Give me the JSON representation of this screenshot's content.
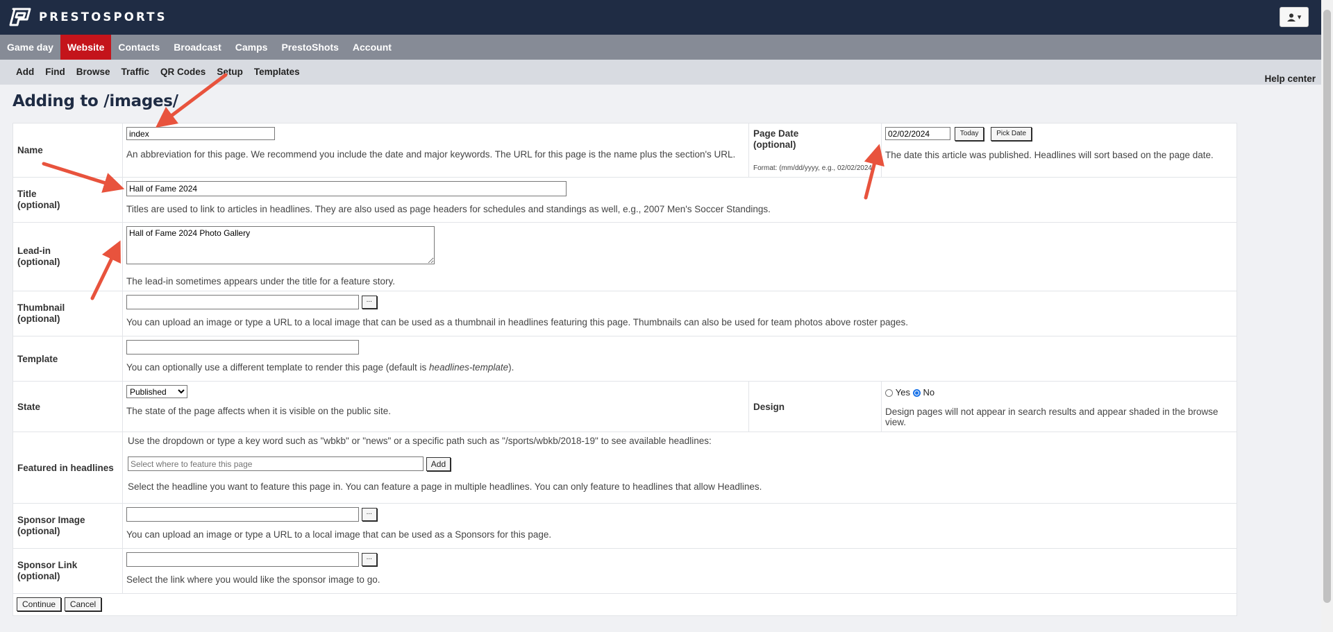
{
  "brand": {
    "name": "PRESTOSPORTS"
  },
  "main_nav": [
    {
      "label": "Game day",
      "active": false
    },
    {
      "label": "Website",
      "active": true
    },
    {
      "label": "Contacts",
      "active": false
    },
    {
      "label": "Broadcast",
      "active": false
    },
    {
      "label": "Camps",
      "active": false
    },
    {
      "label": "PrestoShots",
      "active": false
    },
    {
      "label": "Account",
      "active": false
    }
  ],
  "sub_nav": [
    "Add",
    "Find",
    "Browse",
    "Traffic",
    "QR Codes",
    "Setup",
    "Templates"
  ],
  "help_center": "Help center",
  "page_title": "Adding to /images/",
  "form": {
    "name": {
      "label": "Name",
      "value": "index",
      "help": "An abbreviation for this page. We recommend you include the date and major keywords. The URL for this page is the name plus the section's URL."
    },
    "page_date": {
      "label": "Page Date",
      "optional": "(optional)",
      "value": "02/02/2024",
      "format": "Format: (mm/dd/yyyy, e.g., 02/02/2024)",
      "today_label": "Today",
      "pick_label": "Pick Date",
      "help": "The date this article was published. Headlines will sort based on the page date."
    },
    "title": {
      "label": "Title",
      "optional": "(optional)",
      "value": "Hall of Fame 2024",
      "help": "Titles are used to link to articles in headlines. They are also used as page headers for schedules and standings as well, e.g., 2007 Men's Soccer Standings."
    },
    "leadin": {
      "label": "Lead-in",
      "optional": "(optional)",
      "value": "Hall of Fame 2024 Photo Gallery",
      "help": "The lead-in sometimes appears under the title for a feature story."
    },
    "thumbnail": {
      "label": "Thumbnail",
      "optional": "(optional)",
      "value": "",
      "browse_label": "...",
      "help": "You can upload an image or type a URL to a local image that can be used as a thumbnail in headlines featuring this page. Thumbnails can also be used for team photos above roster pages."
    },
    "template": {
      "label": "Template",
      "value": "",
      "help_prefix": "You can optionally use a different template to render this page (default is ",
      "help_default": "headlines-template",
      "help_suffix": ")."
    },
    "state": {
      "label": "State",
      "selected": "Published",
      "help": "The state of the page affects when it is visible on the public site."
    },
    "design": {
      "label": "Design",
      "yes_label": "Yes",
      "no_label": "No",
      "selected": "No",
      "help": "Design pages will not appear in search results and appear shaded in the browse view."
    },
    "featured": {
      "label": "Featured in headlines",
      "intro": "Use the dropdown or type a key word such as \"wbkb\" or \"news\" or a specific path such as \"/sports/wbkb/2018-19\" to see available headlines:",
      "placeholder": "Select where to feature this page",
      "add_label": "Add",
      "help": "Select the headline you want to feature this page in. You can feature a page in multiple headlines. You can only feature to headlines that allow Headlines."
    },
    "sponsor_image": {
      "label": "Sponsor Image",
      "optional": "(optional)",
      "value": "",
      "browse_label": "...",
      "help": "You can upload an image or type a URL to a local image that can be used as a Sponsors for this page."
    },
    "sponsor_link": {
      "label": "Sponsor Link",
      "optional": "(optional)",
      "value": "",
      "browse_label": "...",
      "help": "Select the link where you would like the sponsor image to go."
    },
    "continue_label": "Continue",
    "cancel_label": "Cancel"
  },
  "colors": {
    "topbar": "#1f2c44",
    "main_nav": "#868b96",
    "active_tab": "#c4141b",
    "sub_nav": "#d8dbe1",
    "annotation_arrow": "#e8533d"
  }
}
